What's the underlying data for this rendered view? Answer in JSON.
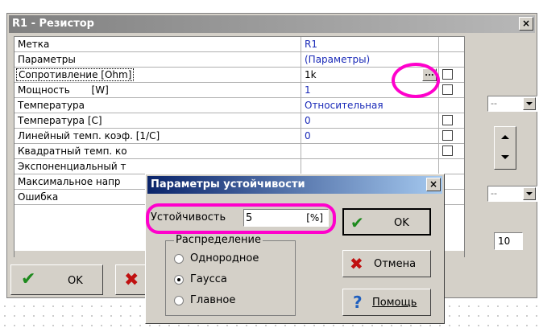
{
  "window": {
    "title": "R1 - Резистор",
    "close": "×"
  },
  "grid": {
    "rows": [
      {
        "label": "Метка",
        "value": "R1"
      },
      {
        "label": "Параметры",
        "value": "(Параметры)"
      },
      {
        "label": "Сопротивление [Ohm]",
        "value": "1k"
      },
      {
        "label": "Мощность       [W]",
        "value": "1"
      },
      {
        "label": "Температура",
        "value": "Относительная"
      },
      {
        "label": "Температура [C]",
        "value": "0"
      },
      {
        "label": "Линейный темп. коэф. [1/C]",
        "value": "0"
      },
      {
        "label": "Квадратный темп. ко",
        "value": ""
      },
      {
        "label": "Экспоненциальный т",
        "value": ""
      },
      {
        "label": "Максимальное напр",
        "value": ""
      },
      {
        "label": "Ошибка",
        "value": ""
      }
    ],
    "ellipsis": "..."
  },
  "right_panel": {
    "combo1": "--",
    "combo2": "--",
    "input": "10"
  },
  "main_buttons": {
    "ok": "OK",
    "cancel": ""
  },
  "dialog": {
    "title": "Параметры устойчивости",
    "close": "×",
    "stability_label": "Устойчивость",
    "stability_value": "5",
    "stability_unit": "[%]",
    "distribution": {
      "legend": "Распределение",
      "options": [
        "Однородное",
        "Гаусса",
        "Главное"
      ],
      "selected": "Гаусса"
    },
    "buttons": {
      "ok": "OK",
      "cancel": "Отмена",
      "help": "Помощь"
    }
  },
  "colors": {
    "highlight": "#ff00cc",
    "value_text": "#1a2ab8",
    "dialog_title": "#0a246a"
  }
}
